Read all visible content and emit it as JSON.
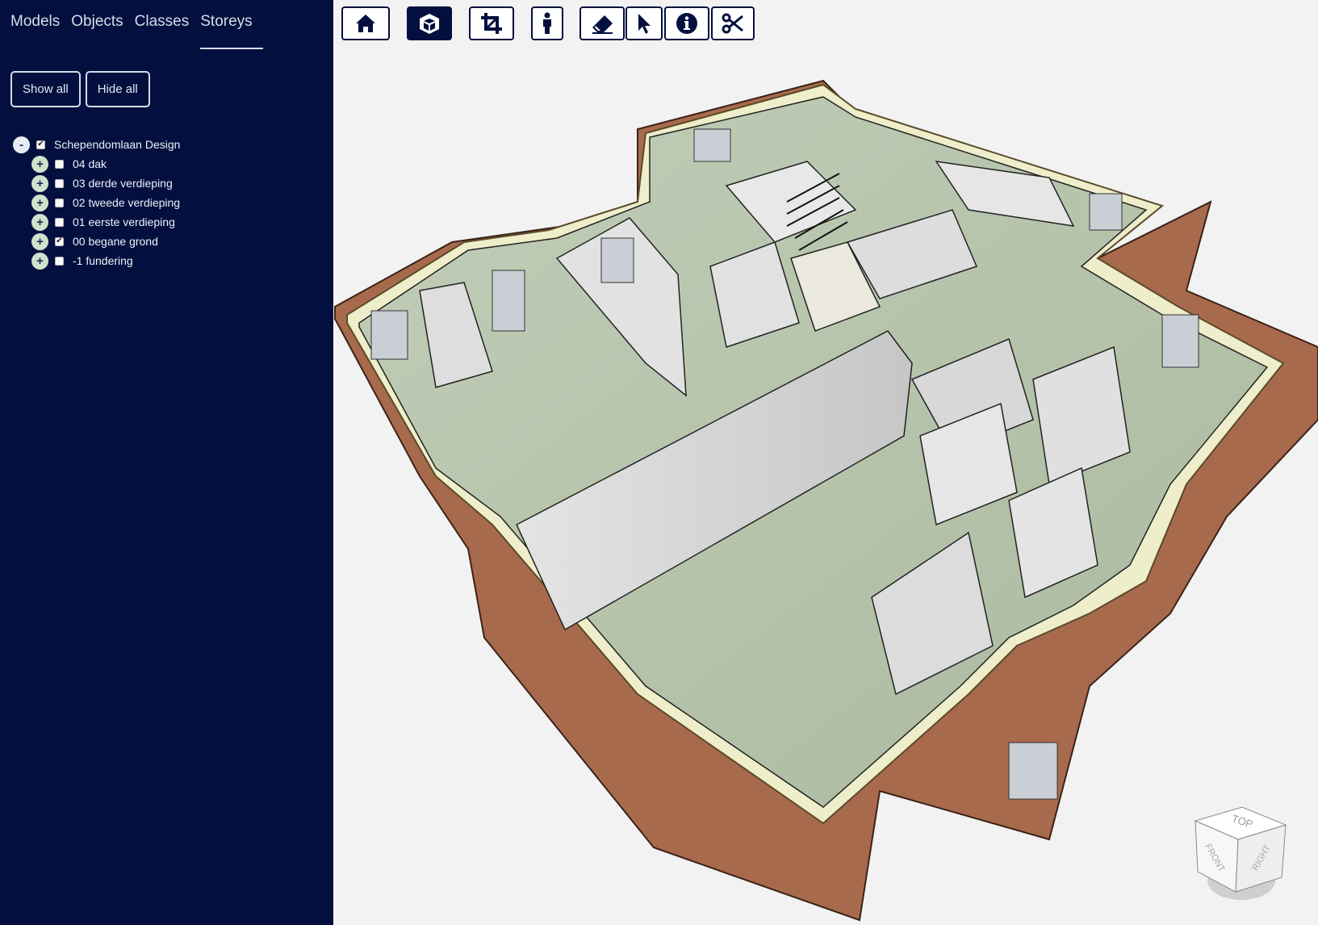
{
  "sidebar": {
    "tabs": [
      {
        "label": "Models"
      },
      {
        "label": "Objects"
      },
      {
        "label": "Classes"
      },
      {
        "label": "Storeys",
        "active": true
      }
    ],
    "show_all_label": "Show all",
    "hide_all_label": "Hide all",
    "tree": {
      "root": {
        "label": "Schependomlaan Design",
        "toggle": "-",
        "checked": true
      },
      "children": [
        {
          "label": "04 dak",
          "toggle": "+",
          "checked": false
        },
        {
          "label": "03 derde verdieping",
          "toggle": "+",
          "checked": false
        },
        {
          "label": "02 tweede verdieping",
          "toggle": "+",
          "checked": false
        },
        {
          "label": "01 eerste verdieping",
          "toggle": "+",
          "checked": false
        },
        {
          "label": "00 begane grond",
          "toggle": "+",
          "checked": true
        },
        {
          "label": "-1 fundering",
          "toggle": "+",
          "checked": false
        }
      ]
    }
  },
  "toolbar": {
    "buttons": [
      {
        "icon": "home-icon",
        "active": false
      },
      {
        "icon": "cube-icon",
        "active": true
      },
      {
        "icon": "crop-icon",
        "active": false
      },
      {
        "icon": "person-icon",
        "active": false
      },
      {
        "icon": "eraser-icon",
        "active": false
      },
      {
        "icon": "pointer-icon",
        "active": false
      },
      {
        "icon": "info-icon",
        "active": false
      },
      {
        "icon": "scissors-icon",
        "active": false
      }
    ]
  },
  "navcube": {
    "top": "TOP",
    "front": "FRONT",
    "right": "RIGHT"
  },
  "colors": {
    "sidebar_bg": "#03103f",
    "accent": "#03103f",
    "floor": "#b8c6ad",
    "brick": "#a86a4c"
  }
}
